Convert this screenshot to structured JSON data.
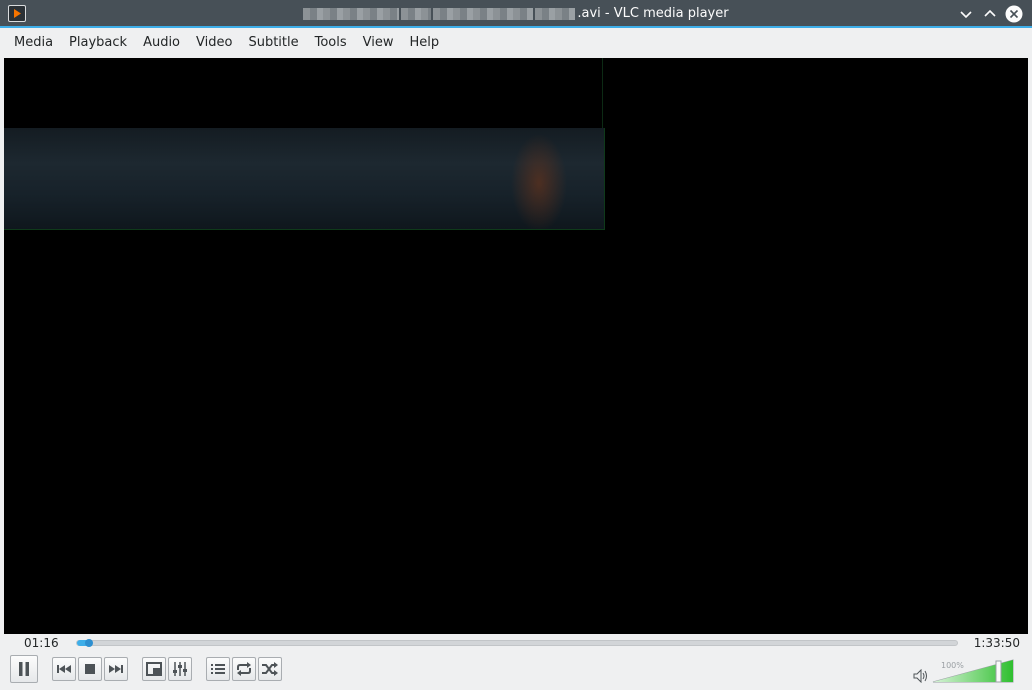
{
  "window": {
    "title_suffix": ".avi - VLC media player",
    "icons": {
      "app": "vlc-icon",
      "minimize": "chevron-down-icon",
      "maximize": "chevron-up-icon",
      "close": "close-icon"
    }
  },
  "menu": [
    "Media",
    "Playback",
    "Audio",
    "Video",
    "Subtitle",
    "Tools",
    "View",
    "Help"
  ],
  "player": {
    "elapsed": "01:16",
    "total": "1:33:50",
    "progress_fraction": 0.0135,
    "volume_label": "100%",
    "volume_fraction": 1.0
  },
  "colors": {
    "accent": "#3daee9",
    "titlebar": "#475057",
    "volume_green": "#2fbf2f"
  },
  "controls": {
    "icons": [
      "pause-icon",
      "previous-icon",
      "stop-icon",
      "next-icon",
      "fullscreen-icon",
      "extended-settings-icon",
      "playlist-icon",
      "loop-icon",
      "shuffle-icon",
      "volume-icon"
    ]
  }
}
